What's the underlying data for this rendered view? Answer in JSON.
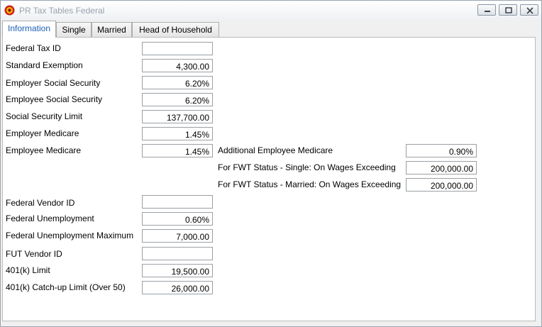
{
  "window": {
    "title": "PR Tax Tables Federal"
  },
  "tabs": [
    {
      "label": "Information",
      "active": true
    },
    {
      "label": "Single",
      "active": false
    },
    {
      "label": "Married",
      "active": false
    },
    {
      "label": "Head of Household",
      "active": false
    }
  ],
  "fields": {
    "federal_tax_id": {
      "label": "Federal Tax ID",
      "value": ""
    },
    "standard_exemption": {
      "label": "Standard Exemption",
      "value": "4,300.00"
    },
    "employer_social_security": {
      "label": "Employer Social Security",
      "value": "6.20%"
    },
    "employee_social_security": {
      "label": "Employee Social Security",
      "value": "6.20%"
    },
    "social_security_limit": {
      "label": "Social Security Limit",
      "value": "137,700.00"
    },
    "employer_medicare": {
      "label": "Employer Medicare",
      "value": "1.45%"
    },
    "employee_medicare": {
      "label": "Employee Medicare",
      "value": "1.45%"
    },
    "additional_employee_medicare": {
      "label": "Additional Employee Medicare",
      "value": "0.90%"
    },
    "fwt_single_exceeding": {
      "label": "For FWT Status - Single: On Wages Exceeding",
      "value": "200,000.00"
    },
    "fwt_married_exceeding": {
      "label": "For FWT Status - Married: On Wages Exceeding",
      "value": "200,000.00"
    },
    "federal_vendor_id": {
      "label": "Federal Vendor ID",
      "value": ""
    },
    "federal_unemployment": {
      "label": "Federal Unemployment",
      "value": "0.60%"
    },
    "federal_unemployment_max": {
      "label": "Federal Unemployment Maximum",
      "value": "7,000.00"
    },
    "fut_vendor_id": {
      "label": "FUT Vendor ID",
      "value": ""
    },
    "k401_limit": {
      "label": "401(k) Limit",
      "value": "19,500.00"
    },
    "k401_catchup_limit": {
      "label": "401(k) Catch-up Limit (Over 50)",
      "value": "26,000.00"
    }
  },
  "colors": {
    "active_tab_text": "#1a5fb4",
    "title_text": "#9ba3ad"
  },
  "icons": {
    "app": "app-gear-icon",
    "minimize": "minimize-icon",
    "maximize": "maximize-icon",
    "close": "close-icon"
  }
}
